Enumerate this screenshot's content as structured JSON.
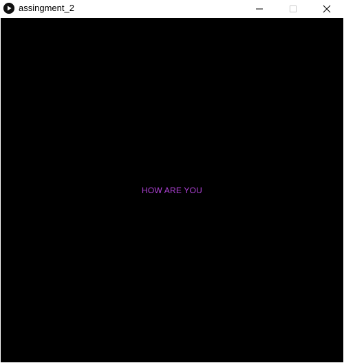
{
  "window": {
    "title": "assingment_2"
  },
  "controls": {
    "minimize": "minimize-icon",
    "maximize": "maximize-icon",
    "close": "close-icon"
  },
  "canvas": {
    "background": "#000000",
    "text": "HOW ARE YOU",
    "text_color": "#b043d8"
  }
}
